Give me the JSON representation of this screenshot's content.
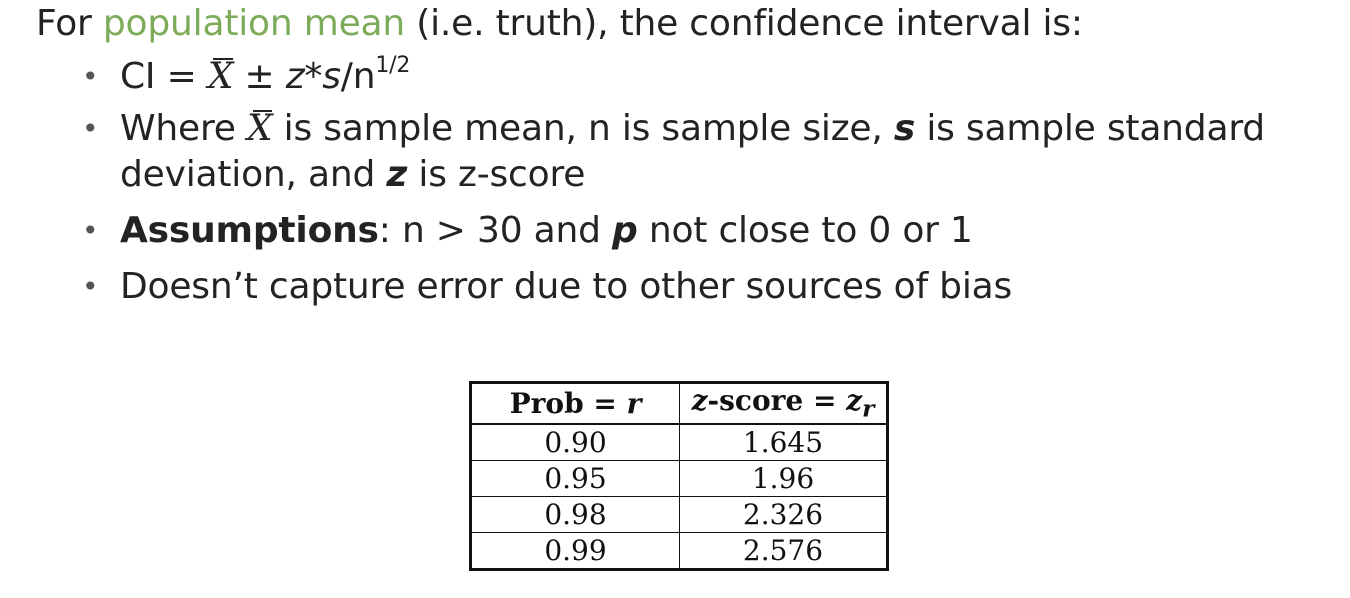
{
  "intro": {
    "before": "For ",
    "highlight": "population mean",
    "after": " (i.e. truth), the confidence interval is:"
  },
  "bullets": {
    "ci": {
      "prefix": "CI = ",
      "xbar": "X",
      "pm": " ± ",
      "z": "z",
      "star": "*",
      "s": "s",
      "div": "/n",
      "exp": "1/2"
    },
    "where": {
      "t1": "Where ",
      "xbar": "X",
      "t2": " is sample mean, n is sample size, ",
      "s": "s",
      "t3": " is sample standard deviation, and ",
      "z": "z",
      "t4": " is z-score"
    },
    "assumptions": {
      "label": "Assumptions",
      "t1": ": n > 30 and ",
      "p": "p",
      "t2": " not close to 0 or 1"
    },
    "bias": "Doesn’t capture error due to other sources of bias"
  },
  "table": {
    "header": {
      "col1_label": "Prob = ",
      "col1_var": "r",
      "col2_z": "z",
      "col2_label": "-score = ",
      "col2_var": "z",
      "col2_sub": "r"
    },
    "rows": [
      {
        "prob": "0.90",
        "z": "1.645"
      },
      {
        "prob": "0.95",
        "z": "1.96"
      },
      {
        "prob": "0.98",
        "z": "2.326"
      },
      {
        "prob": "0.99",
        "z": "2.576"
      }
    ]
  },
  "colors": {
    "accent": "#7cac5a",
    "text": "#232323"
  }
}
